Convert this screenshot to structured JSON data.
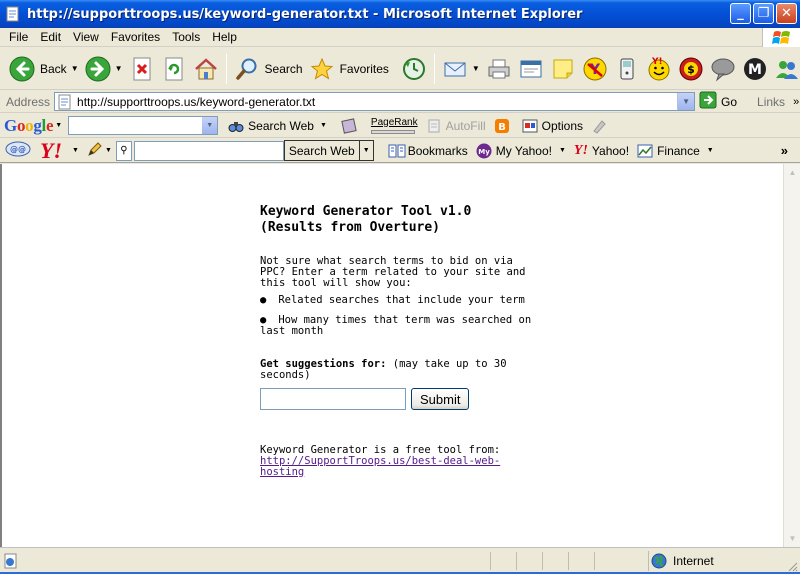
{
  "window": {
    "title": "http://supporttroops.us/keyword-generator.txt - Microsoft Internet Explorer"
  },
  "menu": [
    "File",
    "Edit",
    "View",
    "Favorites",
    "Tools",
    "Help"
  ],
  "toolbar": {
    "back_label": "Back",
    "search_label": "Search",
    "favorites_label": "Favorites"
  },
  "address": {
    "label": "Address",
    "url": "http://supporttroops.us/keyword-generator.txt",
    "go_label": "Go",
    "links_label": "Links"
  },
  "google_toolbar": {
    "logo": "Google",
    "search_web_label": "Search Web",
    "pagerank_label": "PageRank",
    "autofill_label": "AutoFill",
    "options_label": "Options"
  },
  "yahoo_toolbar": {
    "logo": "Y!",
    "search_button_label": "Search Web",
    "bookmarks_label": "Bookmarks",
    "my_yahoo_label": "My Yahoo!",
    "yahoo_label": "Yahoo!",
    "finance_label": "Finance"
  },
  "page": {
    "title_line1": "Keyword Generator Tool v1.0",
    "title_line2": "(Results from Overture)",
    "intro": "Not sure what search terms to bid on via PPC? Enter a term related to your site and this tool will show you:",
    "bullets": [
      "Related searches that include your term",
      "How many times that term was searched on last month"
    ],
    "form_label_bold": "Get suggestions for:",
    "form_label_note": "(may take up to 30 seconds)",
    "keyword_value": "",
    "submit_label": "Submit",
    "footer_text": "Keyword Generator is a free tool from:",
    "footer_link": "http://SupportTroops.us/best-deal-web-hosting"
  },
  "status": {
    "zone_label": "Internet"
  },
  "colors": {
    "titlebar": "#0450d6",
    "link_visited": "#551a8b",
    "yahoo_red": "#d9001b"
  }
}
